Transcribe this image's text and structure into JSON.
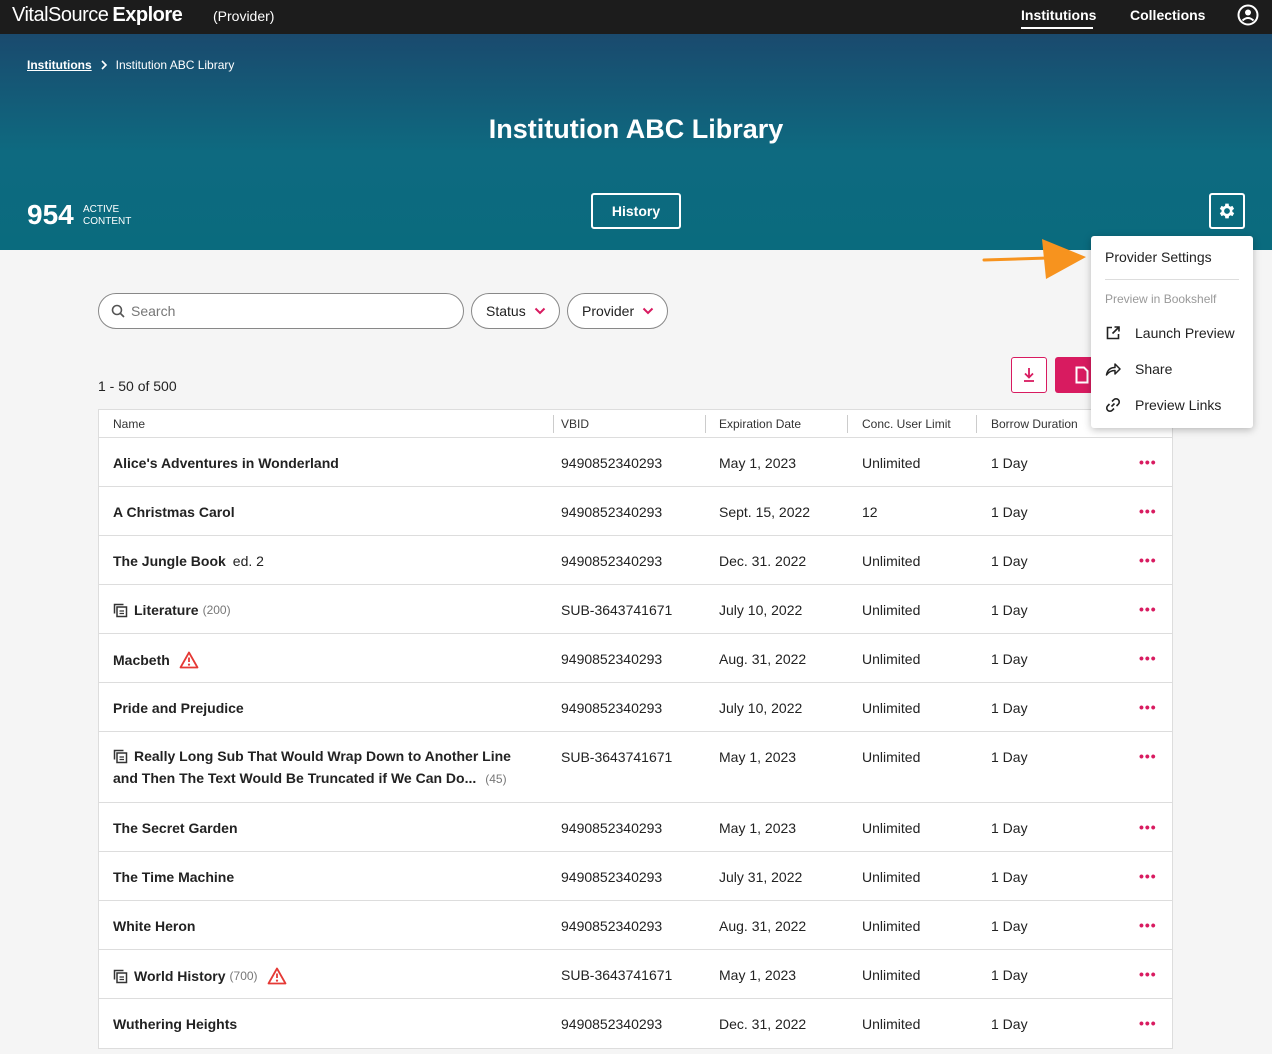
{
  "topbar": {
    "brand_vs": "VitalSource",
    "brand_explore": "Explore",
    "role": "(Provider)",
    "nav": [
      "Institutions",
      "Collections"
    ],
    "user_icon": "user-circle-icon"
  },
  "hero": {
    "breadcrumb_link": "Institutions",
    "breadcrumb_current": "Institution ABC Library",
    "title": "Institution ABC Library",
    "count": "954",
    "count_label_1": "ACTIVE",
    "count_label_2": "CONTENT",
    "history_label": "History",
    "gear_icon": "gear-icon"
  },
  "filters": {
    "search_placeholder": "Search",
    "status_label": "Status",
    "provider_label": "Provider"
  },
  "results": {
    "count_text": "1 - 50 of 500"
  },
  "table": {
    "headers": [
      "Name",
      "VBID",
      "Expiration Date",
      "Conc. User Limit",
      "Borrow Duration"
    ],
    "rows": [
      {
        "name": "Alice's Adventures in Wonderland",
        "vbid": "9490852340293",
        "exp": "May 1, 2023",
        "conc": "Unlimited",
        "borrow": "1 Day"
      },
      {
        "name": "A Christmas Carol",
        "vbid": "9490852340293",
        "exp": "Sept. 15, 2022",
        "conc": "12",
        "borrow": "1 Day"
      },
      {
        "name": "The Jungle Book",
        "edition": "ed. 2",
        "vbid": "9490852340293",
        "exp": "Dec. 31. 2022",
        "conc": "Unlimited",
        "borrow": "1 Day"
      },
      {
        "name": "Literature",
        "count": "(200)",
        "vbid": "SUB-3643741671",
        "exp": "July 10, 2022",
        "conc": "Unlimited",
        "borrow": "1 Day"
      },
      {
        "name": "Macbeth",
        "vbid": "9490852340293",
        "exp": "Aug. 31, 2022",
        "conc": "Unlimited",
        "borrow": "1 Day"
      },
      {
        "name": "Pride and Prejudice",
        "vbid": "9490852340293",
        "exp": "July 10, 2022",
        "conc": "Unlimited",
        "borrow": "1 Day"
      },
      {
        "name_l1": "Really Long Sub That Would Wrap Down to Another Line",
        "name_l2": "and Then The Text Would Be Truncated if We Can Do...",
        "count": "(45)",
        "vbid": "SUB-3643741671",
        "exp": "May 1, 2023",
        "conc": "Unlimited",
        "borrow": "1 Day"
      },
      {
        "name": "The Secret Garden",
        "vbid": "9490852340293",
        "exp": "May 1, 2023",
        "conc": "Unlimited",
        "borrow": "1 Day"
      },
      {
        "name": "The Time Machine",
        "vbid": "9490852340293",
        "exp": "July 31, 2022",
        "conc": "Unlimited",
        "borrow": "1 Day"
      },
      {
        "name": "White Heron",
        "vbid": "9490852340293",
        "exp": "Aug. 31, 2022",
        "conc": "Unlimited",
        "borrow": "1 Day"
      },
      {
        "name": "World History",
        "count": "(700)",
        "vbid": "SUB-3643741671",
        "exp": "May 1, 2023",
        "conc": "Unlimited",
        "borrow": "1 Day"
      },
      {
        "name": "Wuthering Heights",
        "vbid": "9490852340293",
        "exp": "Dec. 31, 2022",
        "conc": "Unlimited",
        "borrow": "1 Day"
      }
    ],
    "more_label": "•••"
  },
  "menu": {
    "head": "Provider Settings",
    "sub": "Preview in Bookshelf",
    "items": [
      "Launch Preview",
      "Share",
      "Preview Links"
    ]
  },
  "colors": {
    "accent": "#d81b60",
    "topbar": "#1c1c1c",
    "hero": "#0e6a80",
    "arrow": "#f7931e"
  }
}
